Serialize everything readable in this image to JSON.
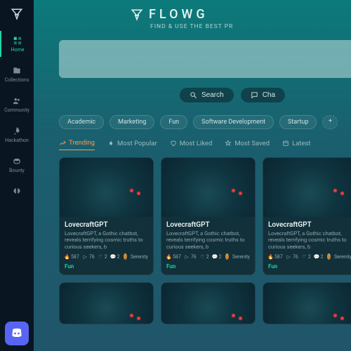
{
  "brand": {
    "name": "FLOWG",
    "tagline": "FIND & USE THE BEST PR"
  },
  "sidebar": {
    "items": [
      {
        "label": "Home"
      },
      {
        "label": "Collections"
      },
      {
        "label": "Community"
      },
      {
        "label": "Hackathon"
      },
      {
        "label": "Bounty"
      },
      {
        "label": ""
      }
    ]
  },
  "actions": {
    "search": "Search",
    "chat": "Cha"
  },
  "chips": [
    "Academic",
    "Marketing",
    "Fun",
    "Software Development",
    "Startup"
  ],
  "tabs": {
    "trending": "Trending",
    "popular": "Most Popular",
    "liked": "Most Liked",
    "saved": "Most Saved",
    "latest": "Latest"
  },
  "card": {
    "title": "LovecraftGPT",
    "desc": "LovecraftGPT, a Gothic chatbot, reveals terrifying cosmic truths to curious seekers, b",
    "views": "587",
    "saves": "76",
    "likes": "2",
    "comments": "2",
    "author": "Serenity",
    "tag": "Fun"
  },
  "colors": {
    "accent": "#1fd7a4",
    "hot": "#ff9a4d",
    "discord": "#5865F2"
  }
}
